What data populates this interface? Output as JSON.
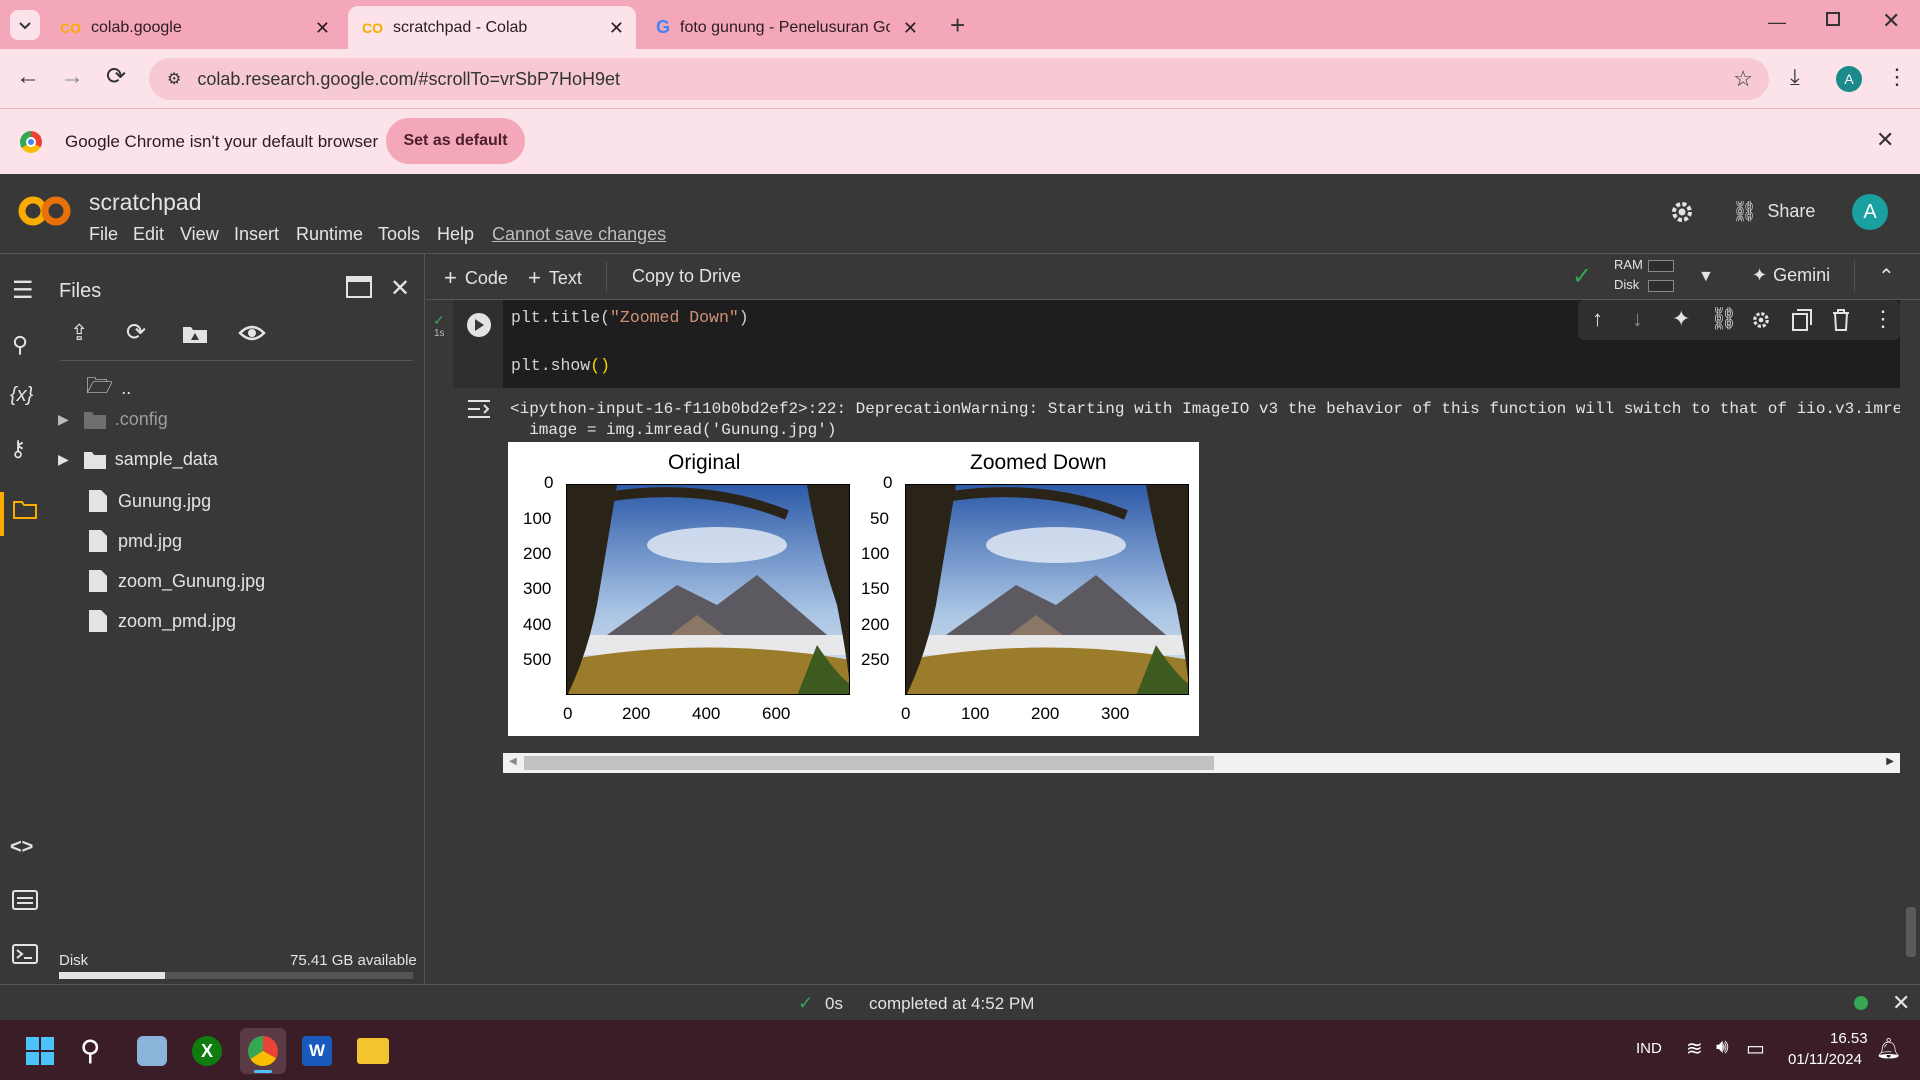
{
  "browser": {
    "tabs": [
      {
        "title": "colab.google"
      },
      {
        "title": "scratchpad - Colab"
      },
      {
        "title": "foto gunung - Penelusuran Goo"
      }
    ],
    "url": "colab.research.google.com/#scrollTo=vrSbP7HoH9et",
    "profile_initial": "A",
    "infobar_text": "Google Chrome isn't your default browser",
    "infobar_button": "Set as default"
  },
  "colab": {
    "notebook_title": "scratchpad",
    "menu": [
      "File",
      "Edit",
      "View",
      "Insert",
      "Runtime",
      "Tools",
      "Help"
    ],
    "save_warning": "Cannot save changes",
    "share_label": "Share",
    "avatar_initial": "A",
    "toolbar": {
      "code_label": "Code",
      "text_label": "Text",
      "copy_label": "Copy to Drive",
      "ram_label": "RAM",
      "disk_label": "Disk",
      "gemini_label": "Gemini"
    }
  },
  "files_panel": {
    "title": "Files",
    "items": [
      {
        "name": "..",
        "type": "folder-up"
      },
      {
        "name": ".config",
        "type": "folder"
      },
      {
        "name": "sample_data",
        "type": "folder"
      },
      {
        "name": "Gunung.jpg",
        "type": "file"
      },
      {
        "name": "pmd.jpg",
        "type": "file"
      },
      {
        "name": "zoom_Gunung.jpg",
        "type": "file"
      },
      {
        "name": "zoom_pmd.jpg",
        "type": "file"
      }
    ],
    "disk_label": "Disk",
    "disk_available": "75.41 GB available",
    "disk_used_fraction": 0.3
  },
  "cell": {
    "exec_time": "1s",
    "code_lines": [
      {
        "text": "plt.title(",
        "str": "\"Zoomed Down\"",
        "tail": ")"
      },
      {
        "text": "plt.show",
        "paren": "()"
      }
    ],
    "output_warning_line1": "<ipython-input-16-f110b0bd2ef2>:22: DeprecationWarning: Starting with ImageIO v3 the behavior of this function will switch to that of iio.v3.imre",
    "output_warning_line2": "  image = img.imread('Gunung.jpg')"
  },
  "figure": {
    "subplots": [
      {
        "title": "Original",
        "yticks": [
          "0",
          "100",
          "200",
          "300",
          "400",
          "500"
        ],
        "xticks": [
          "0",
          "200",
          "400",
          "600"
        ]
      },
      {
        "title": "Zoomed Down",
        "yticks": [
          "0",
          "50",
          "100",
          "150",
          "200",
          "250"
        ],
        "xticks": [
          "0",
          "100",
          "200",
          "300"
        ]
      }
    ]
  },
  "statusbar": {
    "elapsed": "0s",
    "completed": "completed at 4:52 PM"
  },
  "taskbar": {
    "lang": "IND",
    "time": "16.53",
    "date": "01/11/2024"
  },
  "colors": {
    "tab_strip": "#f4a7b8",
    "colab_bg": "#383838",
    "accent_orange": "#f9ab00",
    "success_green": "#34a853"
  }
}
